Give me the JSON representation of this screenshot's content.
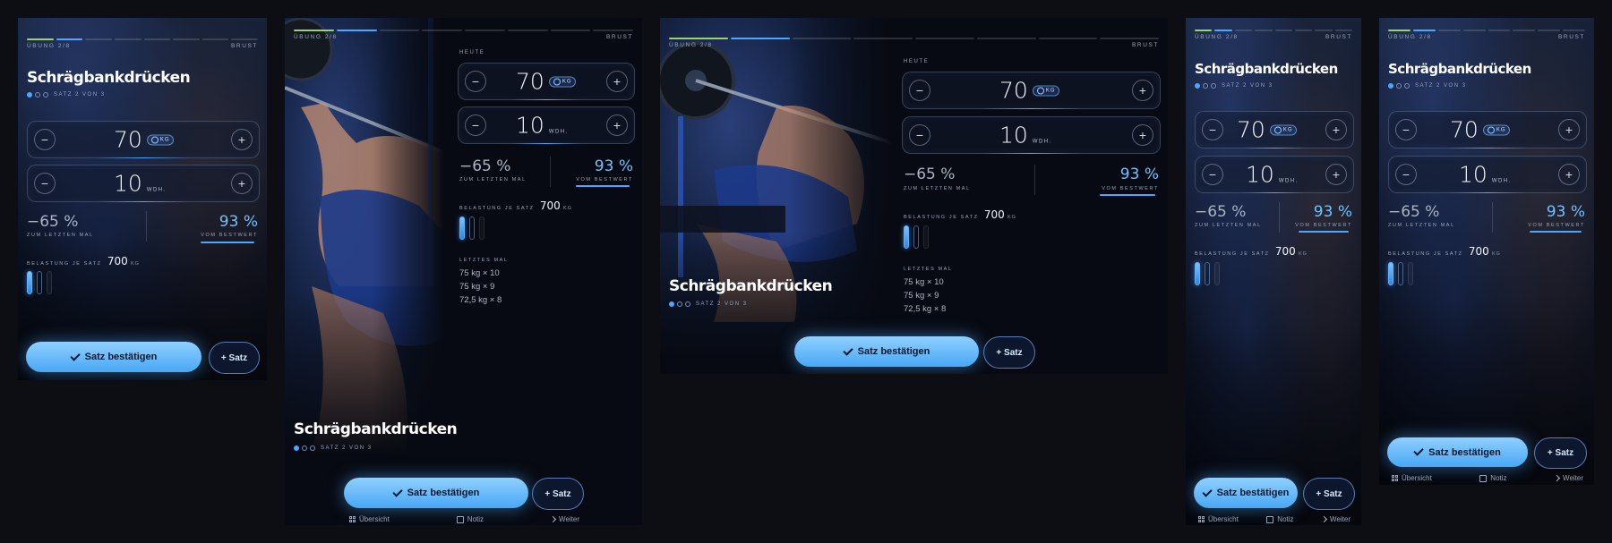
{
  "exercise": {
    "progress_label": "ÜBUNG 2/8",
    "category": "BRUST",
    "name": "Schrägbankdrücken",
    "set_label": "SATZ 2 VON 3",
    "step_segments": [
      "done",
      "current",
      "todo",
      "todo",
      "todo",
      "todo",
      "todo",
      "todo"
    ]
  },
  "today_label": "HEUTE",
  "weight": {
    "value": "70",
    "unit": "KG",
    "minus": "−",
    "plus": "+"
  },
  "reps": {
    "value": "10",
    "unit": "WDH.",
    "minus": "−",
    "plus": "+"
  },
  "stats": {
    "last_delta": "−65 %",
    "last_label": "ZUM LETZTEN MAL",
    "best_pct": "93 %",
    "best_label": "VOM BESTWERT"
  },
  "load": {
    "label": "BELASTUNG JE SATZ",
    "value": "700",
    "unit": "KG",
    "sets_done": 1,
    "sets_total": 3
  },
  "history": {
    "label": "LETZTES MAL",
    "entries": [
      "75 kg × 10",
      "75 kg × 9",
      "72,5 kg × 8"
    ]
  },
  "actions": {
    "confirm": "Satz bestätigen",
    "add_set": "+ Satz"
  },
  "nav": {
    "overview": "Übersicht",
    "note": "Notiz",
    "next": "Weiter"
  },
  "colors": {
    "accent": "#4da6ff",
    "done_segment": "#9ed36a",
    "background": "#0c0e13"
  }
}
